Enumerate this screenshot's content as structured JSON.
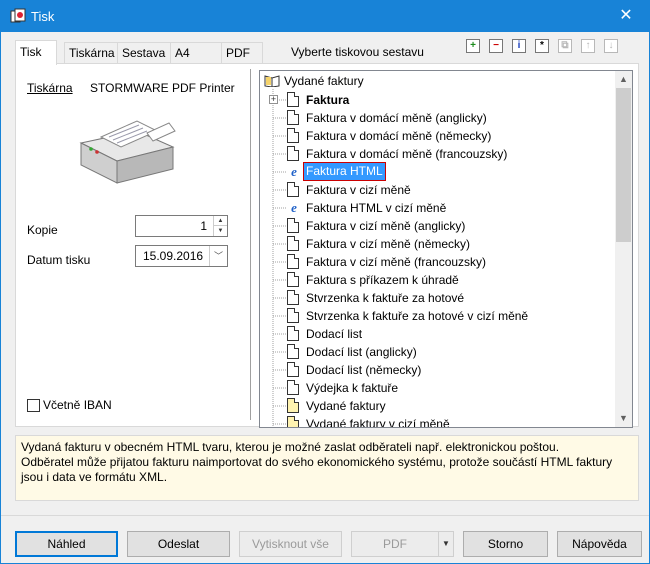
{
  "window": {
    "title": "Tisk",
    "close": "✕"
  },
  "tabs": [
    "Tisk",
    "Tiskárna",
    "Sestava",
    "A4",
    "PDF"
  ],
  "toolbar": {
    "label": "Vyberte tiskovou sestavu",
    "buttons": [
      {
        "icon": "add-icon",
        "glyph": "+",
        "color": "#1a8a1a"
      },
      {
        "icon": "remove-icon",
        "glyph": "−",
        "color": "#cc0000"
      },
      {
        "icon": "info-icon",
        "glyph": "i",
        "color": "#1a3fbf"
      },
      {
        "icon": "star-icon",
        "glyph": "*",
        "color": "#000000"
      },
      {
        "icon": "copy-icon",
        "glyph": "⧉",
        "color": "#b8b8b8"
      },
      {
        "icon": "move-up-icon",
        "glyph": "↑",
        "color": "#b8b8b8"
      },
      {
        "icon": "move-down-icon",
        "glyph": "↓",
        "color": "#b8b8b8"
      }
    ]
  },
  "left": {
    "printer_label": "Tiskárna",
    "printer_name": "STORMWARE PDF Printer",
    "copies_label": "Kopie",
    "copies_value": "1",
    "date_label": "Datum tisku",
    "date_value": "15.09.2016",
    "iban_label": "Včetně IBAN",
    "iban_checked": false
  },
  "tree": {
    "root": "Vydané faktury",
    "items": [
      {
        "label": "Faktura",
        "icon": "doc",
        "bold": true,
        "expander": "+"
      },
      {
        "label": "Faktura v domácí měně (anglicky)",
        "icon": "doc"
      },
      {
        "label": "Faktura v domácí měně (německy)",
        "icon": "doc"
      },
      {
        "label": "Faktura v domácí měně (francouzsky)",
        "icon": "doc"
      },
      {
        "label": "Faktura HTML",
        "icon": "ie",
        "selected": true
      },
      {
        "label": "Faktura v cizí měně",
        "icon": "doc"
      },
      {
        "label": "Faktura HTML v cizí měně",
        "icon": "ie"
      },
      {
        "label": "Faktura v cizí měně (anglicky)",
        "icon": "doc"
      },
      {
        "label": "Faktura v cizí měně (německy)",
        "icon": "doc"
      },
      {
        "label": "Faktura v cizí měně (francouzsky)",
        "icon": "doc"
      },
      {
        "label": "Faktura s příkazem k úhradě",
        "icon": "doc"
      },
      {
        "label": "Stvrzenka k faktuře za hotové",
        "icon": "doc"
      },
      {
        "label": "Stvrzenka k faktuře za hotové v cizí měně",
        "icon": "doc"
      },
      {
        "label": "Dodací list",
        "icon": "doc"
      },
      {
        "label": "Dodací list (anglicky)",
        "icon": "doc"
      },
      {
        "label": "Dodací list (německy)",
        "icon": "doc"
      },
      {
        "label": "Výdejka k faktuře",
        "icon": "doc"
      },
      {
        "label": "Vydané faktury",
        "icon": "doc-yellow"
      },
      {
        "label": "Vydané faktury v cizí měně",
        "icon": "doc-yellow"
      }
    ]
  },
  "description": {
    "lines": [
      "Vydaná fakturu v obecném HTML tvaru, kterou je možné zaslat odběrateli např. elektronickou poštou.",
      "Odběratel může přijatou fakturu naimportovat do svého ekonomického systému, protože součástí HTML faktury",
      "jsou i data ve formátu XML."
    ]
  },
  "buttons": {
    "preview": "Náhled",
    "send": "Odeslat",
    "print_all": "Vytisknout vše",
    "pdf": "PDF",
    "cancel": "Storno",
    "help": "Nápověda"
  }
}
